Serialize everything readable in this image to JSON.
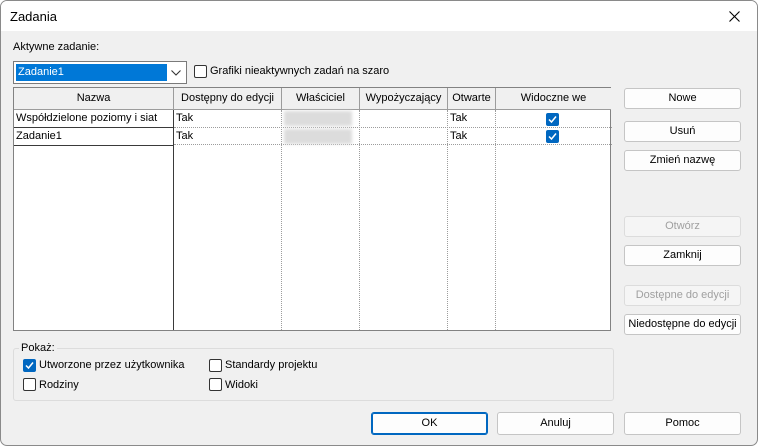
{
  "window": {
    "title": "Zadania"
  },
  "active": {
    "label": "Aktywne zadanie:",
    "value": "Zadanie1",
    "gray_label": "Grafiki nieaktywnych zadań na szaro"
  },
  "table": {
    "columns": [
      "Nazwa",
      "Dostępny do edycji",
      "Właściciel",
      "Wypożyczający",
      "Otwarte",
      "Widoczne we"
    ],
    "rows": [
      {
        "name": "Współdzielone poziomy i siat",
        "editable": "Tak",
        "owner": "",
        "borrower": "",
        "open": "Tak",
        "visible": true
      },
      {
        "name": "Zadanie1",
        "editable": "Tak",
        "owner": "",
        "borrower": "",
        "open": "Tak",
        "visible": true
      }
    ]
  },
  "buttons": {
    "new": "Nowe",
    "delete": "Usuń",
    "rename": "Zmień nazwę",
    "open": "Otwórz",
    "close": "Zamknij",
    "make_editable": "Dostępne do edycji",
    "make_non_editable": "Niedostępne do edycji",
    "ok": "OK",
    "cancel": "Anuluj",
    "help": "Pomoc"
  },
  "show": {
    "title": "Pokaż:",
    "user_created": {
      "label": "Utworzone przez użytkownika",
      "checked": true
    },
    "families": {
      "label": "Rodziny",
      "checked": false
    },
    "project_standards": {
      "label": "Standardy projektu",
      "checked": false
    },
    "views": {
      "label": "Widoki",
      "checked": false
    }
  },
  "colors": {
    "accent": "#0067c0",
    "selection": "#0078d7"
  }
}
